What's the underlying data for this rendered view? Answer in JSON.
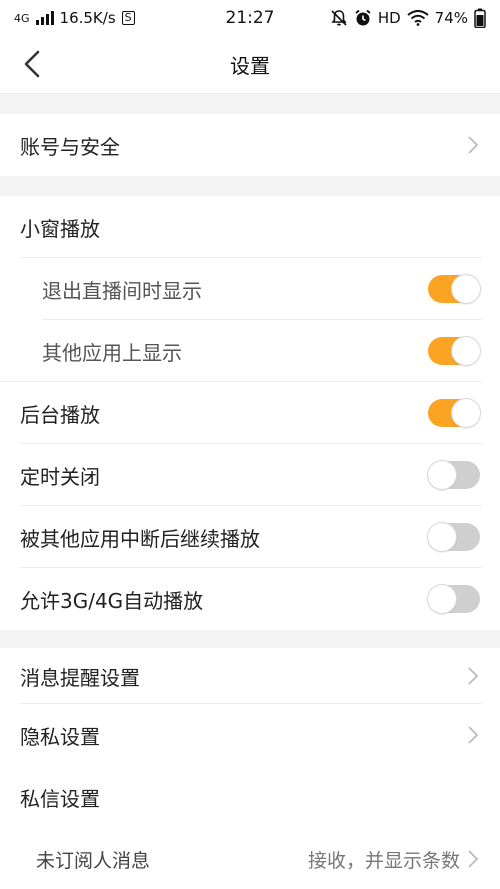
{
  "status_bar": {
    "network": "4G",
    "speed": "16.5K/s",
    "s_badge": "S",
    "time": "21:27",
    "hd": "HD",
    "battery": "74%"
  },
  "header": {
    "title": "设置"
  },
  "sections": {
    "account": {
      "label": "账号与安全"
    },
    "playback": {
      "title": "小窗播放",
      "exit_live": {
        "label": "退出直播间时显示",
        "on": true
      },
      "other_apps": {
        "label": "其他应用上显示",
        "on": true
      },
      "background": {
        "label": "后台播放",
        "on": true
      },
      "timer_close": {
        "label": "定时关闭",
        "on": false
      },
      "resume_after_interrupt": {
        "label": "被其他应用中断后继续播放",
        "on": false
      },
      "autoplay_3g4g": {
        "label": "允许3G/4G自动播放",
        "on": false
      }
    },
    "notifications": {
      "label": "消息提醒设置"
    },
    "privacy": {
      "label": "隐私设置"
    },
    "private_message": {
      "title": "私信设置",
      "unsubscribed": {
        "label": "未订阅人消息",
        "value": "接收，并显示条数"
      }
    }
  },
  "colors": {
    "accent": "#fba423",
    "toggle_off": "#cfcfcf"
  }
}
